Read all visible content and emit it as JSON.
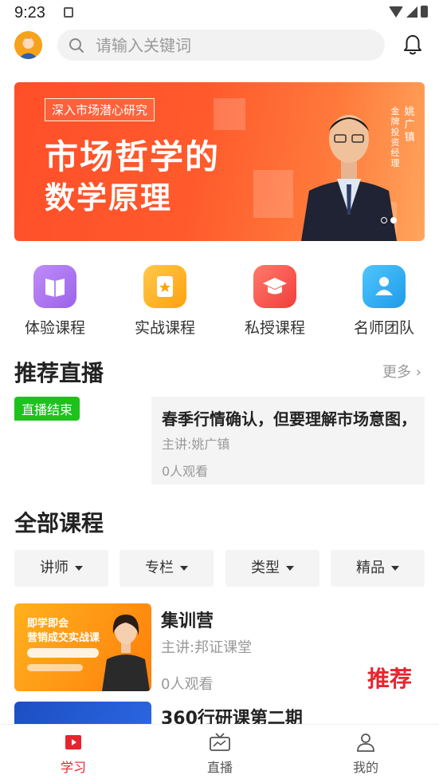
{
  "status_bar": {
    "time": "9:23"
  },
  "search": {
    "placeholder": "请输入关键词"
  },
  "banner": {
    "tag": "深入市场潜心研究",
    "line1": "市场哲学的",
    "line2": "数学原理",
    "side_role": "金牌投资经理",
    "side_name": "姚广镇"
  },
  "categories": [
    {
      "label": "体验课程",
      "icon": "book-icon",
      "color": "#b07bf0"
    },
    {
      "label": "实战课程",
      "icon": "notebook-star-icon",
      "color": "#ffb526"
    },
    {
      "label": "私授课程",
      "icon": "graduation-cap-icon",
      "color": "#ff5a52"
    },
    {
      "label": "名师团队",
      "icon": "teacher-icon",
      "color": "#33b3f5"
    }
  ],
  "live_section": {
    "title": "推荐直播",
    "more": "更多",
    "badge": "直播结束",
    "item": {
      "title": "春季行情确认，但要理解市场意图，",
      "teacher": "主讲:姚广镇",
      "views": "0人观看"
    }
  },
  "courses_section": {
    "title": "全部课程",
    "filters": [
      "讲师",
      "专栏",
      "类型",
      "精品"
    ],
    "items": [
      {
        "title": "集训营",
        "teacher": "主讲:邦证课堂",
        "views": "0人观看",
        "badge": "推荐",
        "thumb_line1": "即学即会",
        "thumb_line2": "营销成交实战课"
      },
      {
        "title": "360行研课第二期"
      }
    ]
  },
  "bottom_nav": [
    {
      "label": "学习",
      "active": true
    },
    {
      "label": "直播",
      "active": false
    },
    {
      "label": "我的",
      "active": false
    }
  ],
  "colors": {
    "accent": "#e8242e",
    "live_badge": "#1dc21d",
    "banner": "#ff5a2c"
  }
}
